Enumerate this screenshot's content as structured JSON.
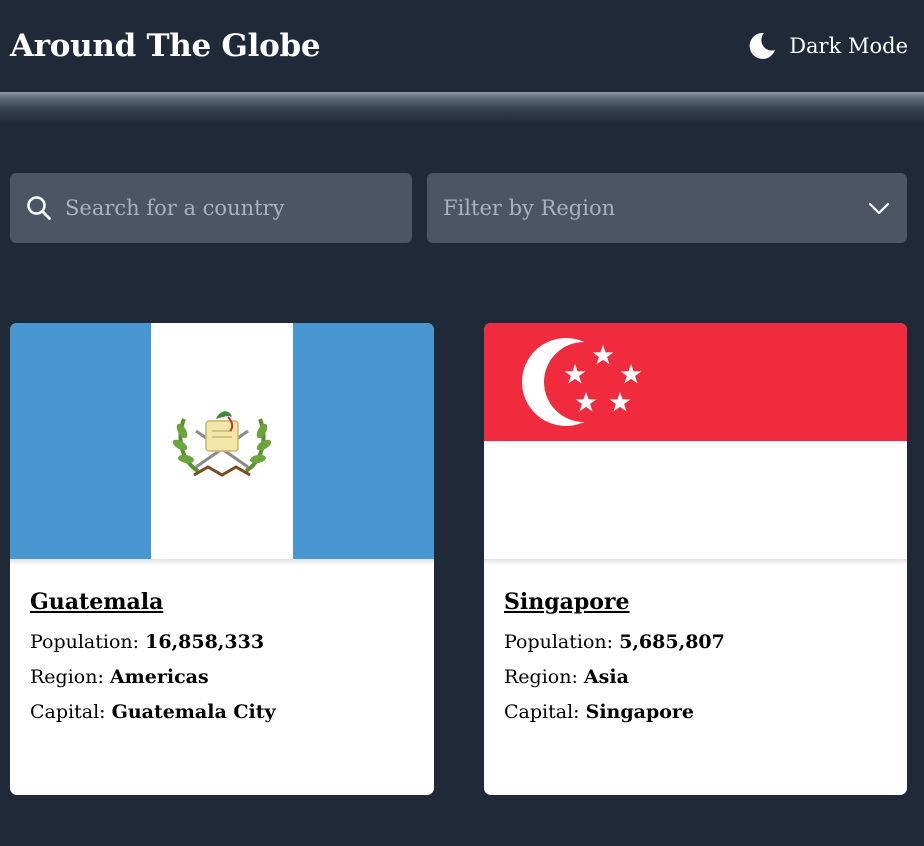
{
  "header": {
    "title": "Around The Globe",
    "theme_toggle_label": "Dark Mode",
    "theme_icon": "moon-icon"
  },
  "search": {
    "placeholder": "Search for a country",
    "value": "",
    "icon": "search-icon"
  },
  "filter": {
    "label": "Filter by Region",
    "icon": "chevron-down-icon"
  },
  "labels": {
    "population": "Population: ",
    "region": "Region: ",
    "capital": "Capital: "
  },
  "countries": [
    {
      "name": "Guatemala",
      "population": "16,858,333",
      "region": "Americas",
      "capital": "Guatemala City",
      "flag_colors": {
        "blue": "#4997d0",
        "white": "#ffffff"
      }
    },
    {
      "name": "Singapore",
      "population": "5,685,807",
      "region": "Asia",
      "capital": "Singapore",
      "flag_colors": {
        "red": "#ef2b3d",
        "white": "#ffffff"
      }
    }
  ],
  "colors": {
    "background": "#1f2937",
    "input_bg": "#4b5563",
    "card_bg": "#ffffff"
  }
}
